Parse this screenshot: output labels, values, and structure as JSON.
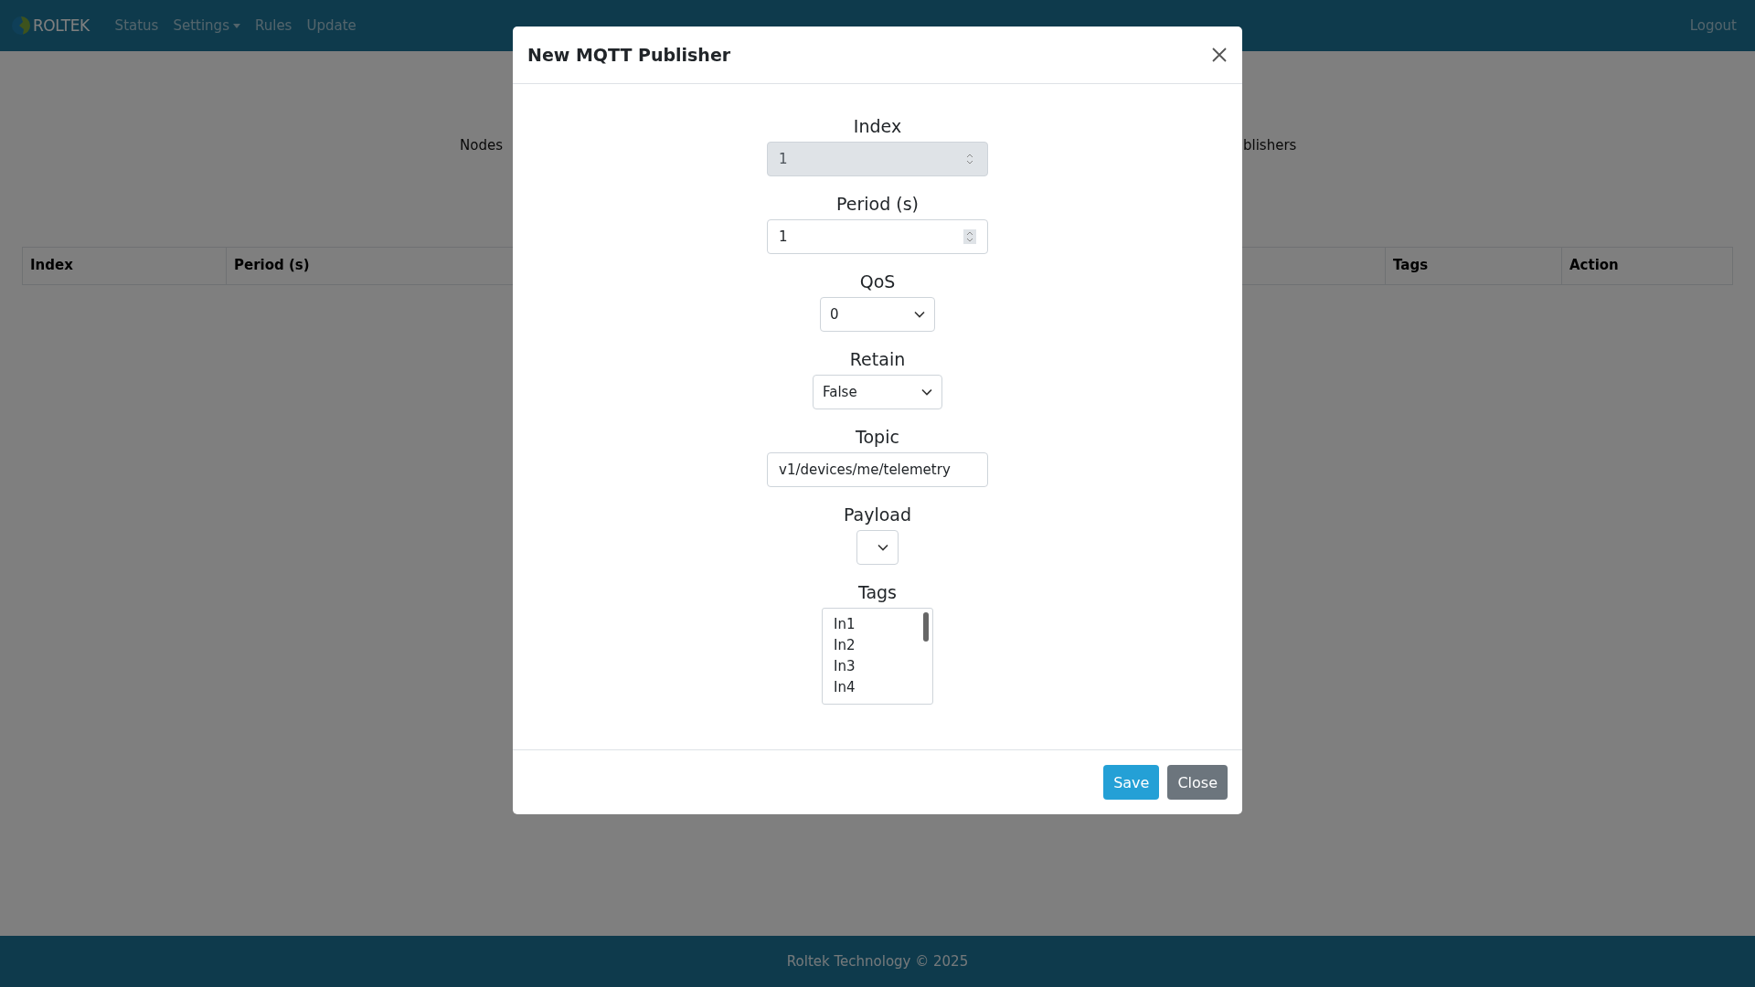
{
  "navbar": {
    "brand": "ROLTEK",
    "items": [
      {
        "label": "Status",
        "kind": "link"
      },
      {
        "label": "Settings",
        "kind": "dropdown"
      },
      {
        "label": "Rules",
        "kind": "link"
      },
      {
        "label": "Update",
        "kind": "link"
      }
    ],
    "logout": "Logout"
  },
  "page": {
    "tabs": [
      "Nodes",
      "blishers"
    ],
    "table": {
      "columns": [
        {
          "label": "Index"
        },
        {
          "label": "Period (s)"
        },
        {
          "label": "Tags"
        },
        {
          "label": "Action"
        }
      ]
    }
  },
  "dialog": {
    "title": "New MQTT Publisher",
    "fields": [
      {
        "label": "Index",
        "kind": "number",
        "value": "1",
        "disabled": true
      },
      {
        "label": "Period (s)",
        "kind": "number",
        "value": "1",
        "disabled": false
      },
      {
        "label": "QoS",
        "kind": "select",
        "value": "0"
      },
      {
        "label": "Retain",
        "kind": "select",
        "value": "False"
      },
      {
        "label": "Topic",
        "kind": "text",
        "value": "v1/devices/me/telemetry"
      },
      {
        "label": "Payload",
        "kind": "select"
      },
      {
        "label": "Tags",
        "kind": "listbox",
        "options": [
          "In1",
          "In2",
          "In3",
          "In4"
        ]
      }
    ],
    "buttons": [
      {
        "label": "Save",
        "kind": "primary"
      },
      {
        "label": "Close",
        "kind": "secondary"
      }
    ]
  },
  "footer": "Roltek Technology © 2025"
}
